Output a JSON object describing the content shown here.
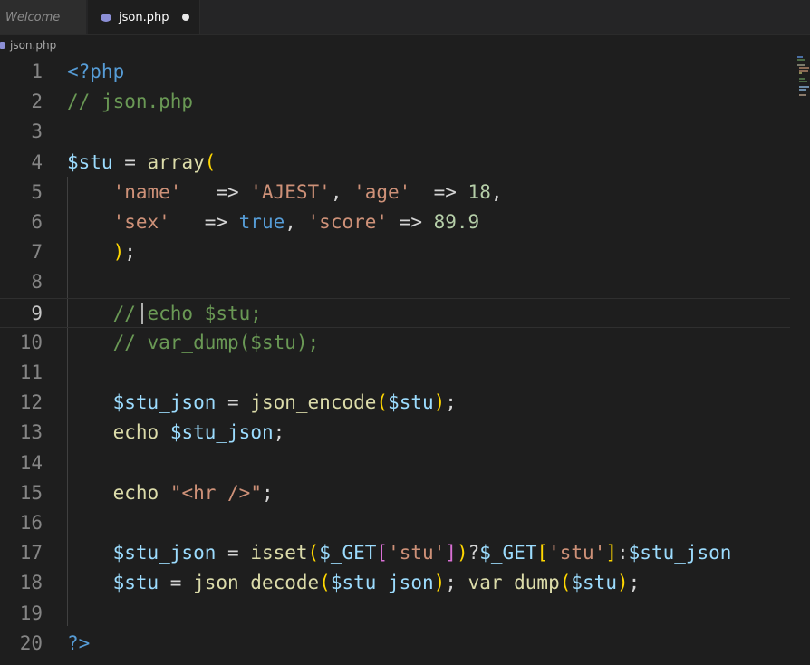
{
  "tabs": [
    {
      "label": "Welcome"
    },
    {
      "label": "json.php"
    }
  ],
  "breadcrumb": {
    "file": "json.php"
  },
  "editor": {
    "active_line": 9,
    "lines": [
      {
        "n": "1",
        "tokens": [
          [
            "<?php",
            "#569cd6"
          ]
        ]
      },
      {
        "n": "2",
        "tokens": [
          [
            "// json.php",
            "#6a9955"
          ]
        ]
      },
      {
        "n": "3",
        "tokens": []
      },
      {
        "n": "4",
        "tokens": [
          [
            "$stu",
            "#9cdcfe"
          ],
          [
            " = ",
            "#d4d4d4"
          ],
          [
            "array",
            "#dcdcaa"
          ],
          [
            "(",
            "#ffd700"
          ]
        ]
      },
      {
        "n": "5",
        "tokens": [
          [
            "    ",
            "#d4d4d4"
          ],
          [
            "'name'",
            "#ce9178"
          ],
          [
            "   => ",
            "#d4d4d4"
          ],
          [
            "'AJEST'",
            "#ce9178"
          ],
          [
            ", ",
            "#d4d4d4"
          ],
          [
            "'age'",
            "#ce9178"
          ],
          [
            "  => ",
            "#d4d4d4"
          ],
          [
            "18",
            "#b5cea8"
          ],
          [
            ",",
            "#d4d4d4"
          ]
        ]
      },
      {
        "n": "6",
        "tokens": [
          [
            "    ",
            "#d4d4d4"
          ],
          [
            "'sex'",
            "#ce9178"
          ],
          [
            "   => ",
            "#d4d4d4"
          ],
          [
            "true",
            "#569cd6"
          ],
          [
            ", ",
            "#d4d4d4"
          ],
          [
            "'score'",
            "#ce9178"
          ],
          [
            " => ",
            "#d4d4d4"
          ],
          [
            "89.9",
            "#b5cea8"
          ]
        ]
      },
      {
        "n": "7",
        "tokens": [
          [
            "    ",
            "#d4d4d4"
          ],
          [
            ")",
            "#ffd700"
          ],
          [
            ";",
            "#d4d4d4"
          ]
        ]
      },
      {
        "n": "8",
        "tokens": []
      },
      {
        "n": "9",
        "tokens": [
          [
            "    ",
            "#d4d4d4"
          ],
          [
            "// echo $stu;",
            "#6a9955"
          ]
        ]
      },
      {
        "n": "10",
        "tokens": [
          [
            "    ",
            "#d4d4d4"
          ],
          [
            "// var_dump($stu);",
            "#6a9955"
          ]
        ]
      },
      {
        "n": "11",
        "tokens": []
      },
      {
        "n": "12",
        "tokens": [
          [
            "    ",
            "#d4d4d4"
          ],
          [
            "$stu_json",
            "#9cdcfe"
          ],
          [
            " = ",
            "#d4d4d4"
          ],
          [
            "json_encode",
            "#dcdcaa"
          ],
          [
            "(",
            "#ffd700"
          ],
          [
            "$stu",
            "#9cdcfe"
          ],
          [
            ")",
            "#ffd700"
          ],
          [
            ";",
            "#d4d4d4"
          ]
        ]
      },
      {
        "n": "13",
        "tokens": [
          [
            "    ",
            "#d4d4d4"
          ],
          [
            "echo",
            "#dcdcaa"
          ],
          [
            " ",
            "#d4d4d4"
          ],
          [
            "$stu_json",
            "#9cdcfe"
          ],
          [
            ";",
            "#d4d4d4"
          ]
        ]
      },
      {
        "n": "14",
        "tokens": []
      },
      {
        "n": "15",
        "tokens": [
          [
            "    ",
            "#d4d4d4"
          ],
          [
            "echo",
            "#dcdcaa"
          ],
          [
            " ",
            "#d4d4d4"
          ],
          [
            "\"<hr />\"",
            "#ce9178"
          ],
          [
            ";",
            "#d4d4d4"
          ]
        ]
      },
      {
        "n": "16",
        "tokens": []
      },
      {
        "n": "17",
        "tokens": [
          [
            "    ",
            "#d4d4d4"
          ],
          [
            "$stu_json",
            "#9cdcfe"
          ],
          [
            " = ",
            "#d4d4d4"
          ],
          [
            "isset",
            "#dcdcaa"
          ],
          [
            "(",
            "#ffd700"
          ],
          [
            "$_GET",
            "#9cdcfe"
          ],
          [
            "[",
            "#da70d6"
          ],
          [
            "'stu'",
            "#ce9178"
          ],
          [
            "]",
            "#da70d6"
          ],
          [
            ")",
            "#ffd700"
          ],
          [
            "?",
            "#d4d4d4"
          ],
          [
            "$_GET",
            "#9cdcfe"
          ],
          [
            "[",
            "#ffd700"
          ],
          [
            "'stu'",
            "#ce9178"
          ],
          [
            "]",
            "#ffd700"
          ],
          [
            ":",
            "#d4d4d4"
          ],
          [
            "$stu_json",
            "#9cdcfe"
          ]
        ]
      },
      {
        "n": "18",
        "tokens": [
          [
            "    ",
            "#d4d4d4"
          ],
          [
            "$stu",
            "#9cdcfe"
          ],
          [
            " = ",
            "#d4d4d4"
          ],
          [
            "json_decode",
            "#dcdcaa"
          ],
          [
            "(",
            "#ffd700"
          ],
          [
            "$stu_json",
            "#9cdcfe"
          ],
          [
            ")",
            "#ffd700"
          ],
          [
            "; ",
            "#d4d4d4"
          ],
          [
            "var_dump",
            "#dcdcaa"
          ],
          [
            "(",
            "#ffd700"
          ],
          [
            "$stu",
            "#9cdcfe"
          ],
          [
            ")",
            "#ffd700"
          ],
          [
            ";",
            "#d4d4d4"
          ]
        ]
      },
      {
        "n": "19",
        "tokens": []
      },
      {
        "n": "20",
        "tokens": [
          [
            "?>",
            "#569cd6"
          ]
        ]
      }
    ]
  }
}
